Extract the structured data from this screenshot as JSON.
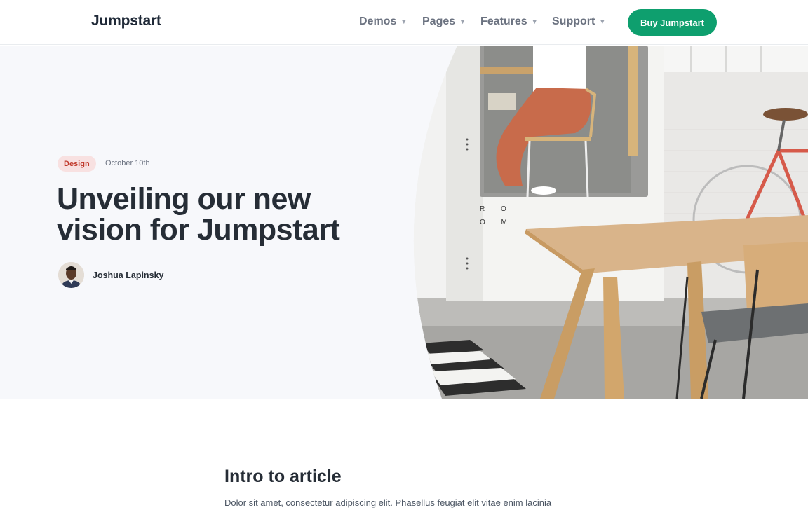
{
  "navbar": {
    "brand": "Jumpstart",
    "items": [
      {
        "label": "Demos"
      },
      {
        "label": "Pages"
      },
      {
        "label": "Features"
      },
      {
        "label": "Support"
      }
    ],
    "cta_label": "Buy Jumpstart"
  },
  "hero": {
    "badge": "Design",
    "date": "October 10th",
    "title": "Unveiling our new vision for Jumpstart",
    "author": "Joshua Lapinsky",
    "room_sign": "R O O M"
  },
  "article": {
    "heading": "Intro to article",
    "paragraph": "Dolor sit amet, consectetur adipiscing elit. Phasellus feugiat elit vitae enim lacinia"
  },
  "colors": {
    "accent": "#0e9f6e",
    "badge_bg": "#f8e1e1",
    "badge_text": "#c0392b",
    "hero_bg": "#f7f8fb",
    "heading": "#262d36"
  },
  "icons": {
    "nav_caret": "caret-down-icon"
  }
}
